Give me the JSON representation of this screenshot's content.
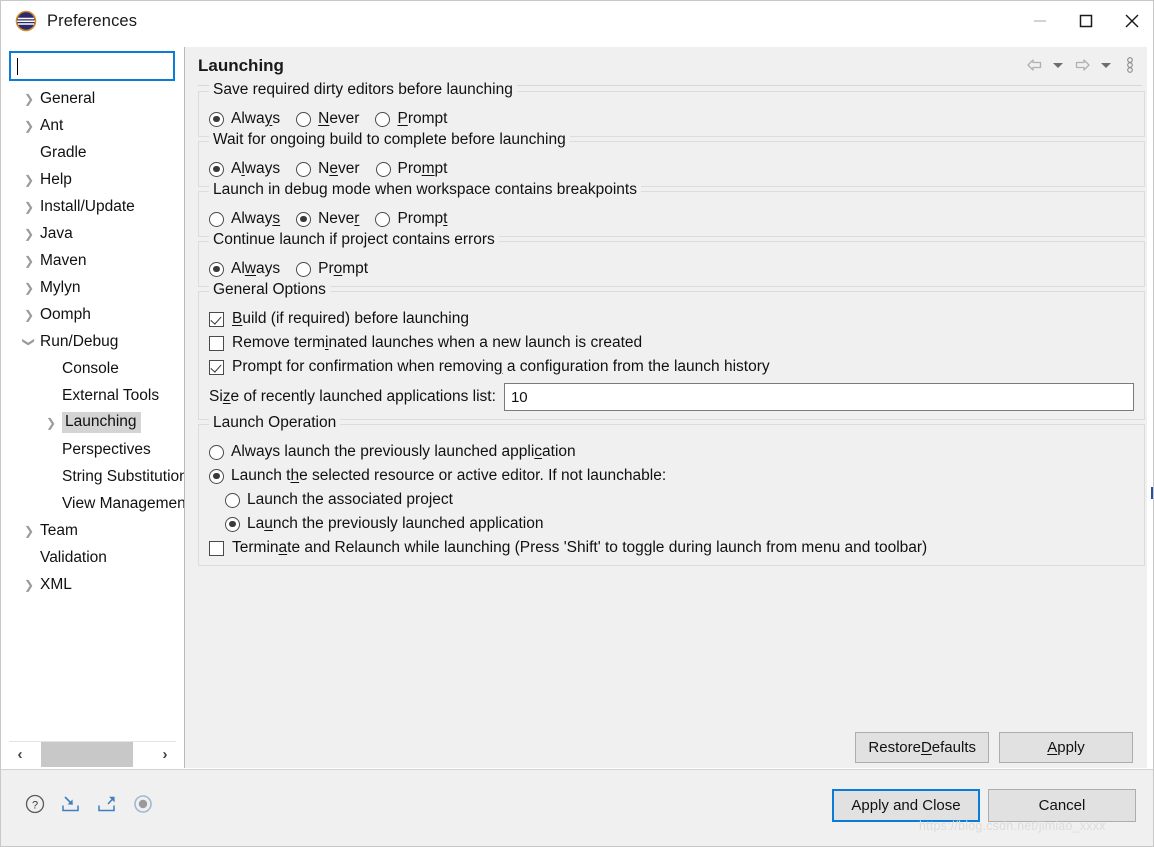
{
  "window": {
    "title": "Preferences",
    "icon": "eclipse-logo-icon",
    "controls": {
      "minimize": "minimize-icon",
      "maximize": "maximize-icon",
      "close": "close-icon"
    }
  },
  "sidebar": {
    "search": {
      "value": "",
      "placeholder": ""
    },
    "items": [
      {
        "label": "General",
        "depth": 0,
        "twisty": "collapsed",
        "selected": false
      },
      {
        "label": "Ant",
        "depth": 0,
        "twisty": "collapsed",
        "selected": false
      },
      {
        "label": "Gradle",
        "depth": 0,
        "twisty": "none",
        "selected": false
      },
      {
        "label": "Help",
        "depth": 0,
        "twisty": "collapsed",
        "selected": false
      },
      {
        "label": "Install/Update",
        "depth": 0,
        "twisty": "collapsed",
        "selected": false
      },
      {
        "label": "Java",
        "depth": 0,
        "twisty": "collapsed",
        "selected": false
      },
      {
        "label": "Maven",
        "depth": 0,
        "twisty": "collapsed",
        "selected": false
      },
      {
        "label": "Mylyn",
        "depth": 0,
        "twisty": "collapsed",
        "selected": false
      },
      {
        "label": "Oomph",
        "depth": 0,
        "twisty": "collapsed",
        "selected": false
      },
      {
        "label": "Run/Debug",
        "depth": 0,
        "twisty": "expanded",
        "selected": false
      },
      {
        "label": "Console",
        "depth": 1,
        "twisty": "none",
        "selected": false
      },
      {
        "label": "External Tools",
        "depth": 1,
        "twisty": "none",
        "selected": false
      },
      {
        "label": "Launching",
        "depth": 1,
        "twisty": "collapsed",
        "selected": true
      },
      {
        "label": "Perspectives",
        "depth": 1,
        "twisty": "none",
        "selected": false
      },
      {
        "label": "String Substitution",
        "depth": 1,
        "twisty": "none",
        "selected": false
      },
      {
        "label": "View Management",
        "depth": 1,
        "twisty": "none",
        "selected": false
      },
      {
        "label": "Team",
        "depth": 0,
        "twisty": "collapsed",
        "selected": false
      },
      {
        "label": "Validation",
        "depth": 0,
        "twisty": "none",
        "selected": false
      },
      {
        "label": "XML",
        "depth": 0,
        "twisty": "collapsed",
        "selected": false
      }
    ],
    "scroll_left_icon": "chevron-left-icon",
    "scroll_right_icon": "chevron-right-icon"
  },
  "page": {
    "title": "Launching",
    "toolbar": {
      "back": "back-arrow-icon",
      "back_menu": "chevron-down-icon",
      "forward": "forward-arrow-icon",
      "forward_menu": "chevron-down-icon",
      "view_menu": "vertical-dots-icon"
    },
    "groups": [
      {
        "title": "Save required dirty editors before launching",
        "options": [
          {
            "pre": "Alwa",
            "mn": "y",
            "post": "s",
            "checked": true
          },
          {
            "pre": "",
            "mn": "N",
            "post": "ever",
            "checked": false
          },
          {
            "pre": "",
            "mn": "P",
            "post": "rompt",
            "checked": false
          }
        ]
      },
      {
        "title": "Wait for ongoing build to complete before launching",
        "options": [
          {
            "pre": "A",
            "mn": "l",
            "post": "ways",
            "checked": true
          },
          {
            "pre": "N",
            "mn": "e",
            "post": "ver",
            "checked": false
          },
          {
            "pre": "Pro",
            "mn": "m",
            "post": "pt",
            "checked": false
          }
        ]
      },
      {
        "title": "Launch in debug mode when workspace contains breakpoints",
        "options": [
          {
            "pre": "Alway",
            "mn": "s",
            "post": "",
            "checked": false
          },
          {
            "pre": "Neve",
            "mn": "r",
            "post": "",
            "checked": true
          },
          {
            "pre": "Promp",
            "mn": "t",
            "post": "",
            "checked": false
          }
        ]
      },
      {
        "title": "Continue launch if project contains errors",
        "options": [
          {
            "pre": "Al",
            "mn": "w",
            "post": "ays",
            "checked": true
          },
          {
            "pre": "Pr",
            "mn": "o",
            "post": "mpt",
            "checked": false
          }
        ]
      }
    ],
    "general_options": {
      "title": "General Options",
      "checks": [
        {
          "pre": "",
          "mn": "B",
          "post": "uild (if required) before launching",
          "checked": true
        },
        {
          "pre": "Remove term",
          "mn": "i",
          "post": "nated launches when a new launch is created",
          "checked": false
        },
        {
          "pre": "Prompt for confirmation when removin",
          "mn": "g",
          "post": " a configuration from the launch history",
          "checked": true
        }
      ],
      "size_label_pre": "Si",
      "size_label_mn": "z",
      "size_label_post": "e of recently launched applications list:",
      "size_value": "10"
    },
    "launch_operation": {
      "title": "Launch Operation",
      "options": [
        {
          "pre": "Always launch the previously launched appli",
          "mn": "c",
          "post": "ation",
          "checked": false,
          "indent": false
        },
        {
          "pre": "Launch t",
          "mn": "h",
          "post": "e selected resource or active editor. If not launchable:",
          "checked": true,
          "indent": false
        },
        {
          "pre": "Launch the associated project",
          "mn": "",
          "post": "",
          "checked": false,
          "indent": true
        },
        {
          "pre": "La",
          "mn": "u",
          "post": "nch the previously launched application",
          "checked": true,
          "indent": true
        }
      ],
      "terminate_check": {
        "pre": "Termin",
        "mn": "a",
        "post": "te and Relaunch while launching (Press 'Shift' to toggle during launch from menu and toolbar)",
        "checked": false
      }
    }
  },
  "buttons": {
    "restore_defaults_pre": "Restore ",
    "restore_defaults_mn": "D",
    "restore_defaults_post": "efaults",
    "apply_pre": "",
    "apply_mn": "A",
    "apply_post": "pply",
    "apply_and_close": "Apply and Close",
    "cancel": "Cancel"
  },
  "footer": {
    "icons": [
      "help-icon",
      "import-icon",
      "export-icon",
      "toggle-icon"
    ]
  },
  "watermark": "https://blog.csdn.net/jimiao_xxxx",
  "colors": {
    "accent": "#0a7bd6",
    "panel_bg": "#f0f0f0",
    "button_bg": "#e1e1e1",
    "selection": "#d4d4d4",
    "group_border": "#dcdcdc"
  }
}
